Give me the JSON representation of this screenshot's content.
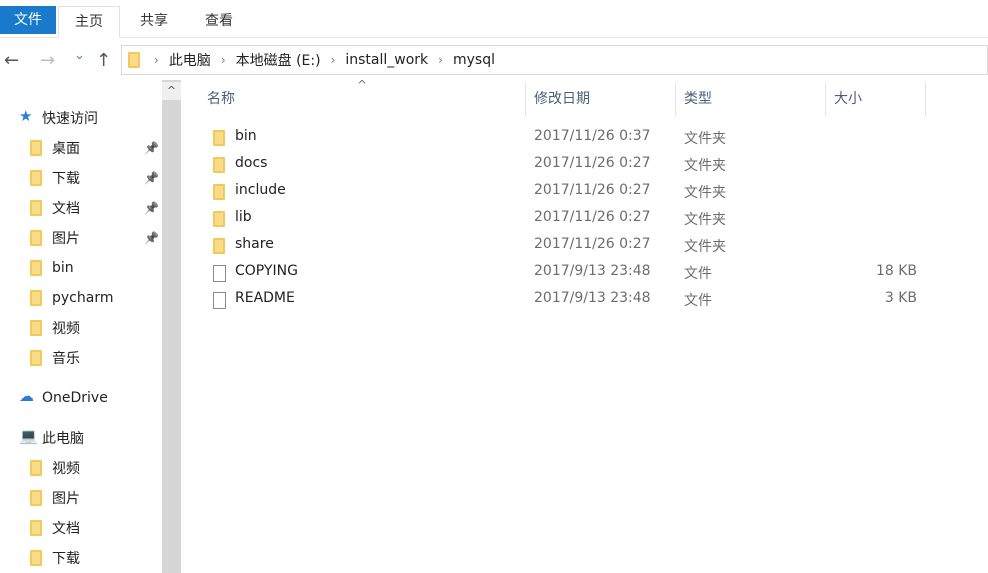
{
  "ribbon": {
    "tabs": [
      "文件",
      "主页",
      "共享",
      "查看"
    ]
  },
  "nav": {
    "back": "←",
    "forward": "→",
    "recent": "⌄",
    "up": "↑",
    "breadcrumb": [
      "此电脑",
      "本地磁盘 (E:)",
      "install_work",
      "mysql"
    ]
  },
  "sidebar": {
    "items": [
      {
        "label": "快速访问",
        "icon": "star-icon",
        "top": true
      },
      {
        "label": "桌面",
        "icon": "desktop-folder-icon",
        "pinned": true
      },
      {
        "label": "下载",
        "icon": "download-folder-icon",
        "pinned": true
      },
      {
        "label": "文档",
        "icon": "documents-folder-icon",
        "pinned": true
      },
      {
        "label": "图片",
        "icon": "pictures-folder-icon",
        "pinned": true
      },
      {
        "label": "bin",
        "icon": "folder-icon"
      },
      {
        "label": "pycharm",
        "icon": "folder-icon"
      },
      {
        "label": "视频",
        "icon": "videos-folder-icon"
      },
      {
        "label": "音乐",
        "icon": "music-folder-icon"
      },
      {
        "label": "OneDrive",
        "icon": "cloud-icon",
        "top": true
      },
      {
        "label": "此电脑",
        "icon": "computer-icon",
        "top": true
      },
      {
        "label": "视频",
        "icon": "videos-folder-icon"
      },
      {
        "label": "图片",
        "icon": "pictures-folder-icon"
      },
      {
        "label": "文档",
        "icon": "documents-folder-icon"
      },
      {
        "label": "下载",
        "icon": "download-folder-icon"
      }
    ]
  },
  "columns": [
    "名称",
    "修改日期",
    "类型",
    "大小"
  ],
  "files": [
    {
      "name": "bin",
      "date": "2017/11/26 0:37",
      "type": "文件夹",
      "size": "",
      "kind": "folder"
    },
    {
      "name": "docs",
      "date": "2017/11/26 0:27",
      "type": "文件夹",
      "size": "",
      "kind": "folder"
    },
    {
      "name": "include",
      "date": "2017/11/26 0:27",
      "type": "文件夹",
      "size": "",
      "kind": "folder"
    },
    {
      "name": "lib",
      "date": "2017/11/26 0:27",
      "type": "文件夹",
      "size": "",
      "kind": "folder"
    },
    {
      "name": "share",
      "date": "2017/11/26 0:27",
      "type": "文件夹",
      "size": "",
      "kind": "folder"
    },
    {
      "name": "COPYING",
      "date": "2017/9/13 23:48",
      "type": "文件",
      "size": "18 KB",
      "kind": "file"
    },
    {
      "name": "README",
      "date": "2017/9/13 23:48",
      "type": "文件",
      "size": "3 KB",
      "kind": "file"
    }
  ],
  "colors": {
    "accent": "#1979ca",
    "folder": "#f2ca5b",
    "header_text": "#4c607a"
  }
}
